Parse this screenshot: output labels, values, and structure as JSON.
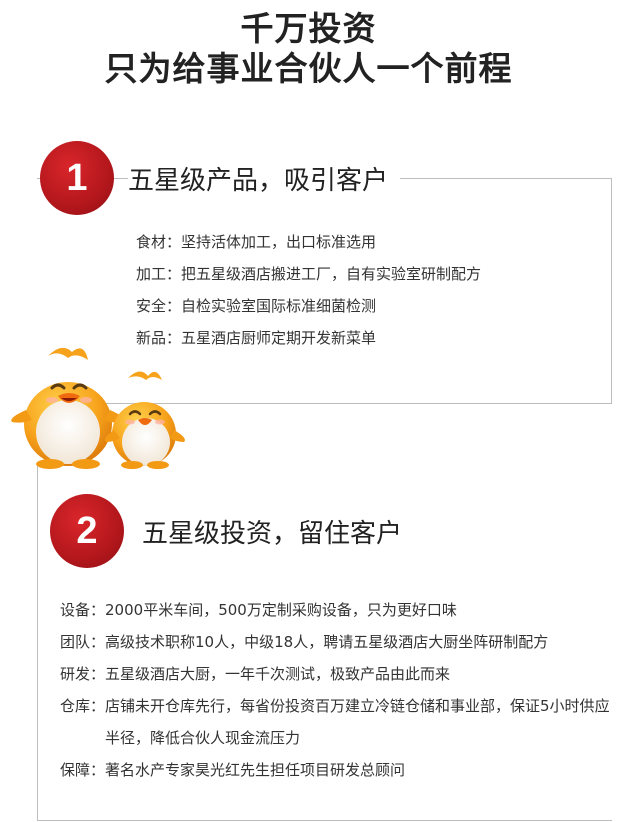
{
  "title": {
    "line1": "千万投资",
    "line2": "只为给事业合伙人一个前程"
  },
  "section1": {
    "number": "1",
    "heading": "五星级产品，吸引客户",
    "items": [
      "食材：坚持活体加工，出口标准选用",
      "加工：把五星级酒店搬进工厂，自有实验室研制配方",
      "安全：自检实验室国际标准细菌检测",
      "新品：五星酒店厨师定期开发新菜单"
    ]
  },
  "section2": {
    "number": "2",
    "heading": "五星级投资，留住客户",
    "items": [
      {
        "key": "设备：",
        "value": "2000平米车间，500万定制采购设备，只为更好口味"
      },
      {
        "key": "团队：",
        "value": "高级技术职称10人，中级18人，聘请五星级酒店大厨坐阵研制配方"
      },
      {
        "key": "研发：",
        "value": "五星级酒店大厨，一年千次测试，极致产品由此而来"
      },
      {
        "key": "仓库：",
        "value": "店铺未开仓库先行，每省份投资百万建立冷链仓储和事业部，保证5小时供应半径，降低合伙人现金流压力"
      },
      {
        "key": "保障：",
        "value": "著名水产专家昊光红先生担任项目研发总顾问"
      }
    ]
  },
  "colors": {
    "badge": "#c41e23",
    "frame": "#bdbdbd",
    "penguin_body": "#f7a21b"
  },
  "illustration": "penguin-mascots"
}
